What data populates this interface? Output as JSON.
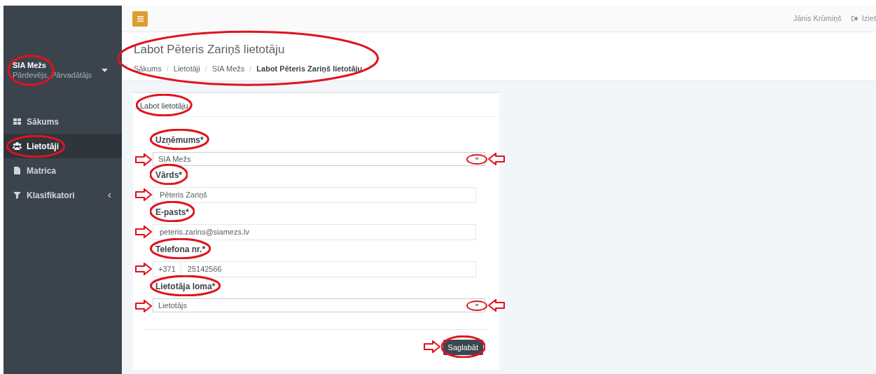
{
  "topbar": {
    "user": "Jānis Krūmiņš",
    "logout": "Iziet"
  },
  "sidebar": {
    "company": {
      "name": "SIA Mežs",
      "roles": "Pārdevējs, Pārvadātājs",
      "circled": true
    },
    "items": [
      {
        "kind": "grid",
        "label": "Sākums",
        "selected": false,
        "circled": false
      },
      {
        "kind": "users",
        "label": "Lietotāji",
        "selected": true,
        "circled": true
      },
      {
        "kind": "file",
        "label": "Matrica",
        "selected": false,
        "circled": false
      },
      {
        "kind": "filter",
        "label": "Klasifikatori",
        "selected": false,
        "circled": false,
        "expandable": true
      }
    ]
  },
  "page": {
    "title": "Labot Pēteris Zariņš lietotāju",
    "breadcrumb_separator": "/",
    "breadcrumb": [
      "Sākums",
      "Lietotāji",
      "SIA Mežs",
      "Labot Pēteris Zariņš lietotāju"
    ],
    "circled": true
  },
  "card": {
    "title": "Labot lietotāju",
    "title_circled": true,
    "fields": [
      {
        "kind": "select",
        "label": "Uzņēmums*",
        "value": "SIA Mežs",
        "label_circled": true,
        "arrow": true,
        "caret_circled": true,
        "caret_arrow": true
      },
      {
        "kind": "text",
        "label": "Vārds*",
        "value": "Pēteris Zariņš",
        "label_circled": true,
        "arrow": true
      },
      {
        "kind": "text",
        "label": "E-pasts*",
        "value": "peteris.zarins@siamezs.lv",
        "label_circled": true,
        "arrow": true
      },
      {
        "kind": "phone",
        "label": "Telefona nr.*",
        "prefix": "+371",
        "value": "25142566",
        "label_circled": true,
        "arrow": true
      },
      {
        "kind": "select",
        "label": "Lietotāja loma*",
        "value": "Lietotājs",
        "label_circled": true,
        "arrow": true,
        "caret_circled": true,
        "caret_arrow": true
      }
    ],
    "save_button": {
      "label": "Saglabāt",
      "circled": true,
      "arrow": true
    }
  }
}
